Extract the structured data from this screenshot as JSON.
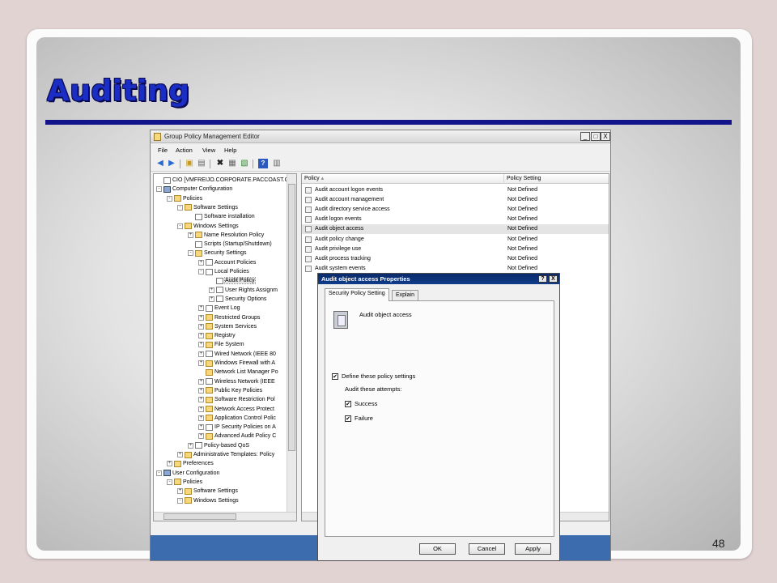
{
  "slide": {
    "title": "Auditing",
    "page_number": "48",
    "accent_color": "#1a2ec6"
  },
  "window": {
    "title": "Group Policy Management Editor",
    "menu": [
      "File",
      "Action",
      "View",
      "Help"
    ],
    "controls": [
      "_",
      "□",
      "X"
    ]
  },
  "tree": [
    {
      "label": "CIO [VMFREIJO.CORPORATE.PACCOAST.C",
      "level": 0,
      "exp": "",
      "icon": "doc"
    },
    {
      "label": "Computer Configuration",
      "level": 0,
      "exp": "-",
      "icon": "pc"
    },
    {
      "label": "Policies",
      "level": 1,
      "exp": "-",
      "icon": "folder"
    },
    {
      "label": "Software Settings",
      "level": 2,
      "exp": "-",
      "icon": "folder"
    },
    {
      "label": "Software installation",
      "level": 3,
      "exp": "",
      "icon": "doc"
    },
    {
      "label": "Windows Settings",
      "level": 2,
      "exp": "-",
      "icon": "folder"
    },
    {
      "label": "Name Resolution Policy",
      "level": 3,
      "exp": "+",
      "icon": "folder"
    },
    {
      "label": "Scripts (Startup/Shutdown)",
      "level": 3,
      "exp": "",
      "icon": "doc"
    },
    {
      "label": "Security Settings",
      "level": 3,
      "exp": "-",
      "icon": "folder"
    },
    {
      "label": "Account Policies",
      "level": 4,
      "exp": "+",
      "icon": "doc"
    },
    {
      "label": "Local Policies",
      "level": 4,
      "exp": "-",
      "icon": "doc"
    },
    {
      "label": "Audit Policy",
      "level": 5,
      "exp": "",
      "icon": "doc",
      "selected": true
    },
    {
      "label": "User Rights Assignm",
      "level": 5,
      "exp": "+",
      "icon": "doc"
    },
    {
      "label": "Security Options",
      "level": 5,
      "exp": "+",
      "icon": "doc"
    },
    {
      "label": "Event Log",
      "level": 4,
      "exp": "+",
      "icon": "doc"
    },
    {
      "label": "Restricted Groups",
      "level": 4,
      "exp": "+",
      "icon": "folder"
    },
    {
      "label": "System Services",
      "level": 4,
      "exp": "+",
      "icon": "folder"
    },
    {
      "label": "Registry",
      "level": 4,
      "exp": "+",
      "icon": "folder"
    },
    {
      "label": "File System",
      "level": 4,
      "exp": "+",
      "icon": "folder"
    },
    {
      "label": "Wired Network (IEEE 80",
      "level": 4,
      "exp": "+",
      "icon": "doc"
    },
    {
      "label": "Windows Firewall with A",
      "level": 4,
      "exp": "+",
      "icon": "folder"
    },
    {
      "label": "Network List Manager Po",
      "level": 4,
      "exp": "",
      "icon": "folder"
    },
    {
      "label": "Wireless Network (IEEE",
      "level": 4,
      "exp": "+",
      "icon": "doc"
    },
    {
      "label": "Public Key Policies",
      "level": 4,
      "exp": "+",
      "icon": "folder"
    },
    {
      "label": "Software Restriction Pol",
      "level": 4,
      "exp": "+",
      "icon": "folder"
    },
    {
      "label": "Network Access Protect",
      "level": 4,
      "exp": "+",
      "icon": "folder"
    },
    {
      "label": "Application Control Polic",
      "level": 4,
      "exp": "+",
      "icon": "folder"
    },
    {
      "label": "IP Security Policies on A",
      "level": 4,
      "exp": "+",
      "icon": "doc"
    },
    {
      "label": "Advanced Audit Policy C",
      "level": 4,
      "exp": "+",
      "icon": "folder"
    },
    {
      "label": "Policy-based QoS",
      "level": 3,
      "exp": "+",
      "icon": "doc"
    },
    {
      "label": "Administrative Templates: Policy",
      "level": 2,
      "exp": "+",
      "icon": "folder"
    },
    {
      "label": "Preferences",
      "level": 1,
      "exp": "+",
      "icon": "folder"
    },
    {
      "label": "User Configuration",
      "level": 0,
      "exp": "-",
      "icon": "pc"
    },
    {
      "label": "Policies",
      "level": 1,
      "exp": "-",
      "icon": "folder"
    },
    {
      "label": "Software Settings",
      "level": 2,
      "exp": "+",
      "icon": "folder"
    },
    {
      "label": "Windows Settings",
      "level": 2,
      "exp": "-",
      "icon": "folder"
    }
  ],
  "list": {
    "columns": [
      "Policy",
      "Policy Setting"
    ],
    "rows": [
      {
        "policy": "Audit account logon events",
        "setting": "Not Defined"
      },
      {
        "policy": "Audit account management",
        "setting": "Not Defined"
      },
      {
        "policy": "Audit directory service access",
        "setting": "Not Defined"
      },
      {
        "policy": "Audit logon events",
        "setting": "Not Defined"
      },
      {
        "policy": "Audit object access",
        "setting": "Not Defined",
        "selected": true
      },
      {
        "policy": "Audit policy change",
        "setting": "Not Defined"
      },
      {
        "policy": "Audit privilege use",
        "setting": "Not Defined"
      },
      {
        "policy": "Audit process tracking",
        "setting": "Not Defined"
      },
      {
        "policy": "Audit system events",
        "setting": "Not Defined"
      }
    ]
  },
  "dialog": {
    "title": "Audit object access Properties",
    "help_label": "?",
    "close_label": "X",
    "tabs": [
      "Security Policy Setting",
      "Explain"
    ],
    "policy_name": "Audit object access",
    "define_label": "Define these policy settings",
    "define_checked": true,
    "audit_attempts_label": "Audit these attempts:",
    "success_label": "Success",
    "success_checked": true,
    "failure_label": "Failure",
    "failure_checked": true,
    "buttons": {
      "ok": "OK",
      "cancel": "Cancel",
      "apply": "Apply"
    }
  }
}
